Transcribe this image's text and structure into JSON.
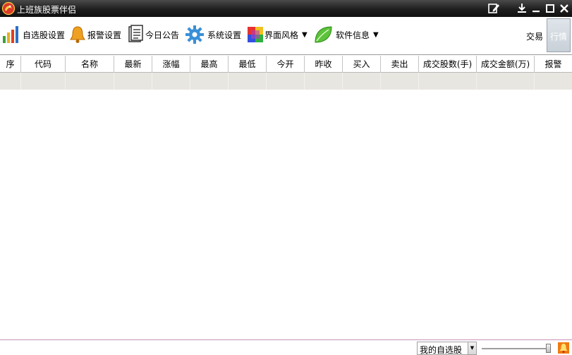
{
  "app": {
    "title": "上班族股票伴侣",
    "accent": "#c0392b"
  },
  "titlebar": {
    "buttons": [
      "edit-icon",
      "pin-icon",
      "minimize-icon",
      "maximize-icon",
      "close-icon"
    ]
  },
  "toolbar": {
    "items": [
      {
        "label": "自选股设置",
        "icon": "bar-chart-icon"
      },
      {
        "label": "报警设置",
        "icon": "bell-icon"
      },
      {
        "label": "今日公告",
        "icon": "document-icon"
      },
      {
        "label": "系统设置",
        "icon": "gear-icon"
      },
      {
        "label": "界面风格",
        "icon": "palette-icon",
        "arrow": "▼"
      },
      {
        "label": "软件信息",
        "icon": "leaf-icon",
        "arrow": "▼"
      }
    ],
    "trade_label": "交易",
    "quote_label": "行情"
  },
  "table": {
    "headers": [
      "序",
      "代码",
      "名称",
      "最新",
      "涨幅",
      "最高",
      "最低",
      "今开",
      "昨收",
      "买入",
      "卖出",
      "成交股数(手)",
      "成交金额(万)",
      "报警"
    ]
  },
  "statusbar": {
    "list_select": "我的自选股",
    "dropdown_arrow": "▼",
    "opacity_level": 1.0
  }
}
